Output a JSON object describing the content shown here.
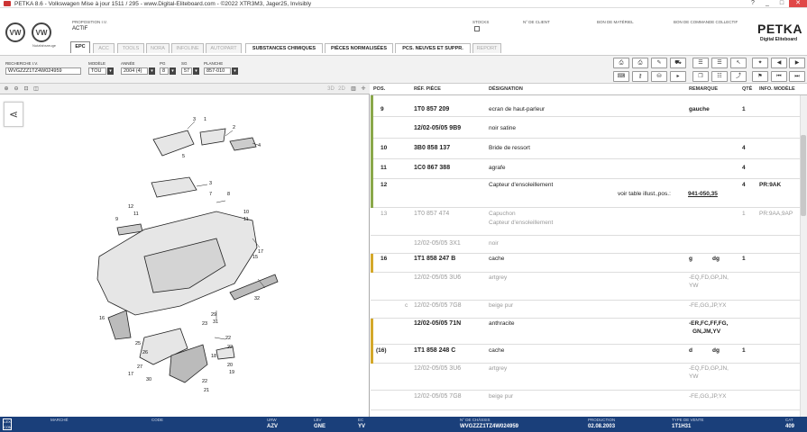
{
  "window": {
    "title": "PETKA 8.6 - Volkswagen Mise à jour 1511 / 295 - www.Digital-Eliteboard.com - ©2022 XTR3M3, Jager25, Invisibly",
    "btn_help": "?",
    "btn_minimize": "_",
    "btn_maximize": "□",
    "btn_close": "✕"
  },
  "header": {
    "brand1": "VW",
    "brand2": "VW",
    "brand_caption": "Nutzfahrzeuge",
    "proposition_label": "PROPOSITION I.V.",
    "proposition_value": "ACTIF",
    "stocks_label": "STOCKS",
    "client_label": "N° DE CLIENT",
    "materiel_label": "BON DE MATÉRIEL",
    "commande_label": "BON DE COMMANDE COLLECTIF",
    "petka": "PETKA",
    "petka_sub": "Digital Eliteboard"
  },
  "tabs": [
    "EPC",
    "ACC",
    "TOOLS",
    "NORA",
    "INFOLINE",
    "AUTOPART",
    "SUBSTANCES CHIMIQUES",
    "PIÈCES NORMALISÉES",
    "PCS. NEUVES ET SUPPR.",
    "REPORT"
  ],
  "search": {
    "recherche_label": "RECHERCHE I.V.",
    "recherche_value": "WVGZZZ1TZ4W024959",
    "modele_label": "MODÈLE",
    "modele_value": "TOU",
    "annee_label": "ANNÉE",
    "annee_value": "2004 (4)",
    "pg_label": "PG",
    "pg_value": "8",
    "sg_label": "SG",
    "sg_value": "57",
    "planche_label": "PLANCHE",
    "planche_value": "857-010"
  },
  "left_toolbar": {
    "zoom_in": "⊕",
    "zoom_out": "⊖",
    "zoom_fit": "⊡",
    "zoom_box": "◫",
    "label_3d": "3D",
    "label_2d": "2D",
    "share": "⋖"
  },
  "diagram_labels": [
    "1",
    "2",
    "3",
    "4",
    "5",
    "6",
    "7",
    "8",
    "9",
    "10",
    "11",
    "12",
    "13",
    "14",
    "15",
    "16",
    "17",
    "18",
    "19",
    "20",
    "21",
    "22",
    "23",
    "24",
    "25",
    "26",
    "27",
    "28",
    "29",
    "30",
    "31",
    "32"
  ],
  "table": {
    "headers": {
      "pos": "POS.",
      "ref": "RÉF. PIÈCE",
      "des": "DÉSIGNATION",
      "rem": "REMARQUE",
      "qte": "QTÉ",
      "info": "INFO. MODÈLE"
    },
    "rows": [
      {
        "pos": "9",
        "ref": "1T0 857 209",
        "des": "ecran de haut-parleur",
        "rem": "gauche",
        "qte": "1",
        "info": ""
      },
      {
        "pos": "",
        "ref": "12/02-05/05 9B9",
        "des": "noir satine",
        "rem": "",
        "qte": "",
        "info": ""
      },
      {
        "pos": "10",
        "ref": "3B0 858 137",
        "des": "Bride de ressort",
        "rem": "",
        "qte": "4",
        "info": ""
      },
      {
        "pos": "11",
        "ref": "1C0 867 388",
        "des": "agrafe",
        "rem": "",
        "qte": "4",
        "info": ""
      },
      {
        "pos": "12",
        "ref": "",
        "des": "Capteur d'ensoleillement",
        "rem": "",
        "qte": "4",
        "info": "PR:9AK",
        "note": "voir table illust.,pos.:",
        "note_link": "941-050,35"
      },
      {
        "pos": "13",
        "ref": "1T0 857 474",
        "des": "Capuchon",
        "des2": "Capteur d'ensoleillement",
        "rem": "",
        "qte": "1",
        "info": "PR:9AA,9AP"
      },
      {
        "pos": "",
        "ref": "12/02-05/05 3X1",
        "des": "noir",
        "rem": "",
        "qte": "",
        "info": ""
      },
      {
        "pos": "16",
        "ref": "1T1 858 247 B",
        "des": "cache",
        "rem": "g",
        "rem2": "dg",
        "qte": "1",
        "info": ""
      },
      {
        "pos": "",
        "ref": "12/02-05/05 3U6",
        "des": "artgrey",
        "rem": "-EQ,FD,GP,JN,",
        "rem3": "YW",
        "qte": "",
        "info": ""
      },
      {
        "pos": "c",
        "ref": "12/02-05/05 7G8",
        "des": "beige pur",
        "rem": "-FE,GG,JP,YX",
        "qte": "",
        "info": ""
      },
      {
        "pos": "",
        "ref": "12/02-05/05 71N",
        "des": "anthracite",
        "rem": "-ER,FC,FF,FG,",
        "rem3": "GN,JM,YV",
        "qte": "",
        "info": ""
      },
      {
        "pos": "(16)",
        "ref": "1T1 858 248 C",
        "des": "cache",
        "rem": "d",
        "rem2": "dg",
        "qte": "1",
        "info": ""
      },
      {
        "pos": "",
        "ref": "12/02-05/05 3U6",
        "des": "artgrey",
        "rem": "-EQ,FD,GP,JN,",
        "rem3": "YW",
        "qte": "",
        "info": ""
      },
      {
        "pos": "",
        "ref": "12/02-05/05 7G8",
        "des": "beige pur",
        "rem": "-FE,GG,JP,YX",
        "qte": "",
        "info": ""
      }
    ]
  },
  "statusbar": {
    "lex": "LEX COM",
    "marche_label": "MARCHÉ",
    "code_label": "CODE",
    "urw_label": "URW",
    "urw_value": "AZV",
    "lbv_label": "LBV",
    "lbv_value": "GNE",
    "ec_label": "EC",
    "ec_value": "YV",
    "chassis_label": "N° DE CHÂSSIS",
    "chassis_value": "WVGZZZ1TZ4W024959",
    "production_label": "PRODUCTION",
    "production_value": "02.08.2003",
    "vente_label": "TYPE DE VENTE",
    "vente_value": "1T1H31",
    "cat_label": "CAT",
    "cat_value": "409"
  },
  "colors": {
    "statusbar": "#1a3f7a",
    "bar_green": "#8aa84a",
    "bar_yellow": "#d4a82a"
  }
}
